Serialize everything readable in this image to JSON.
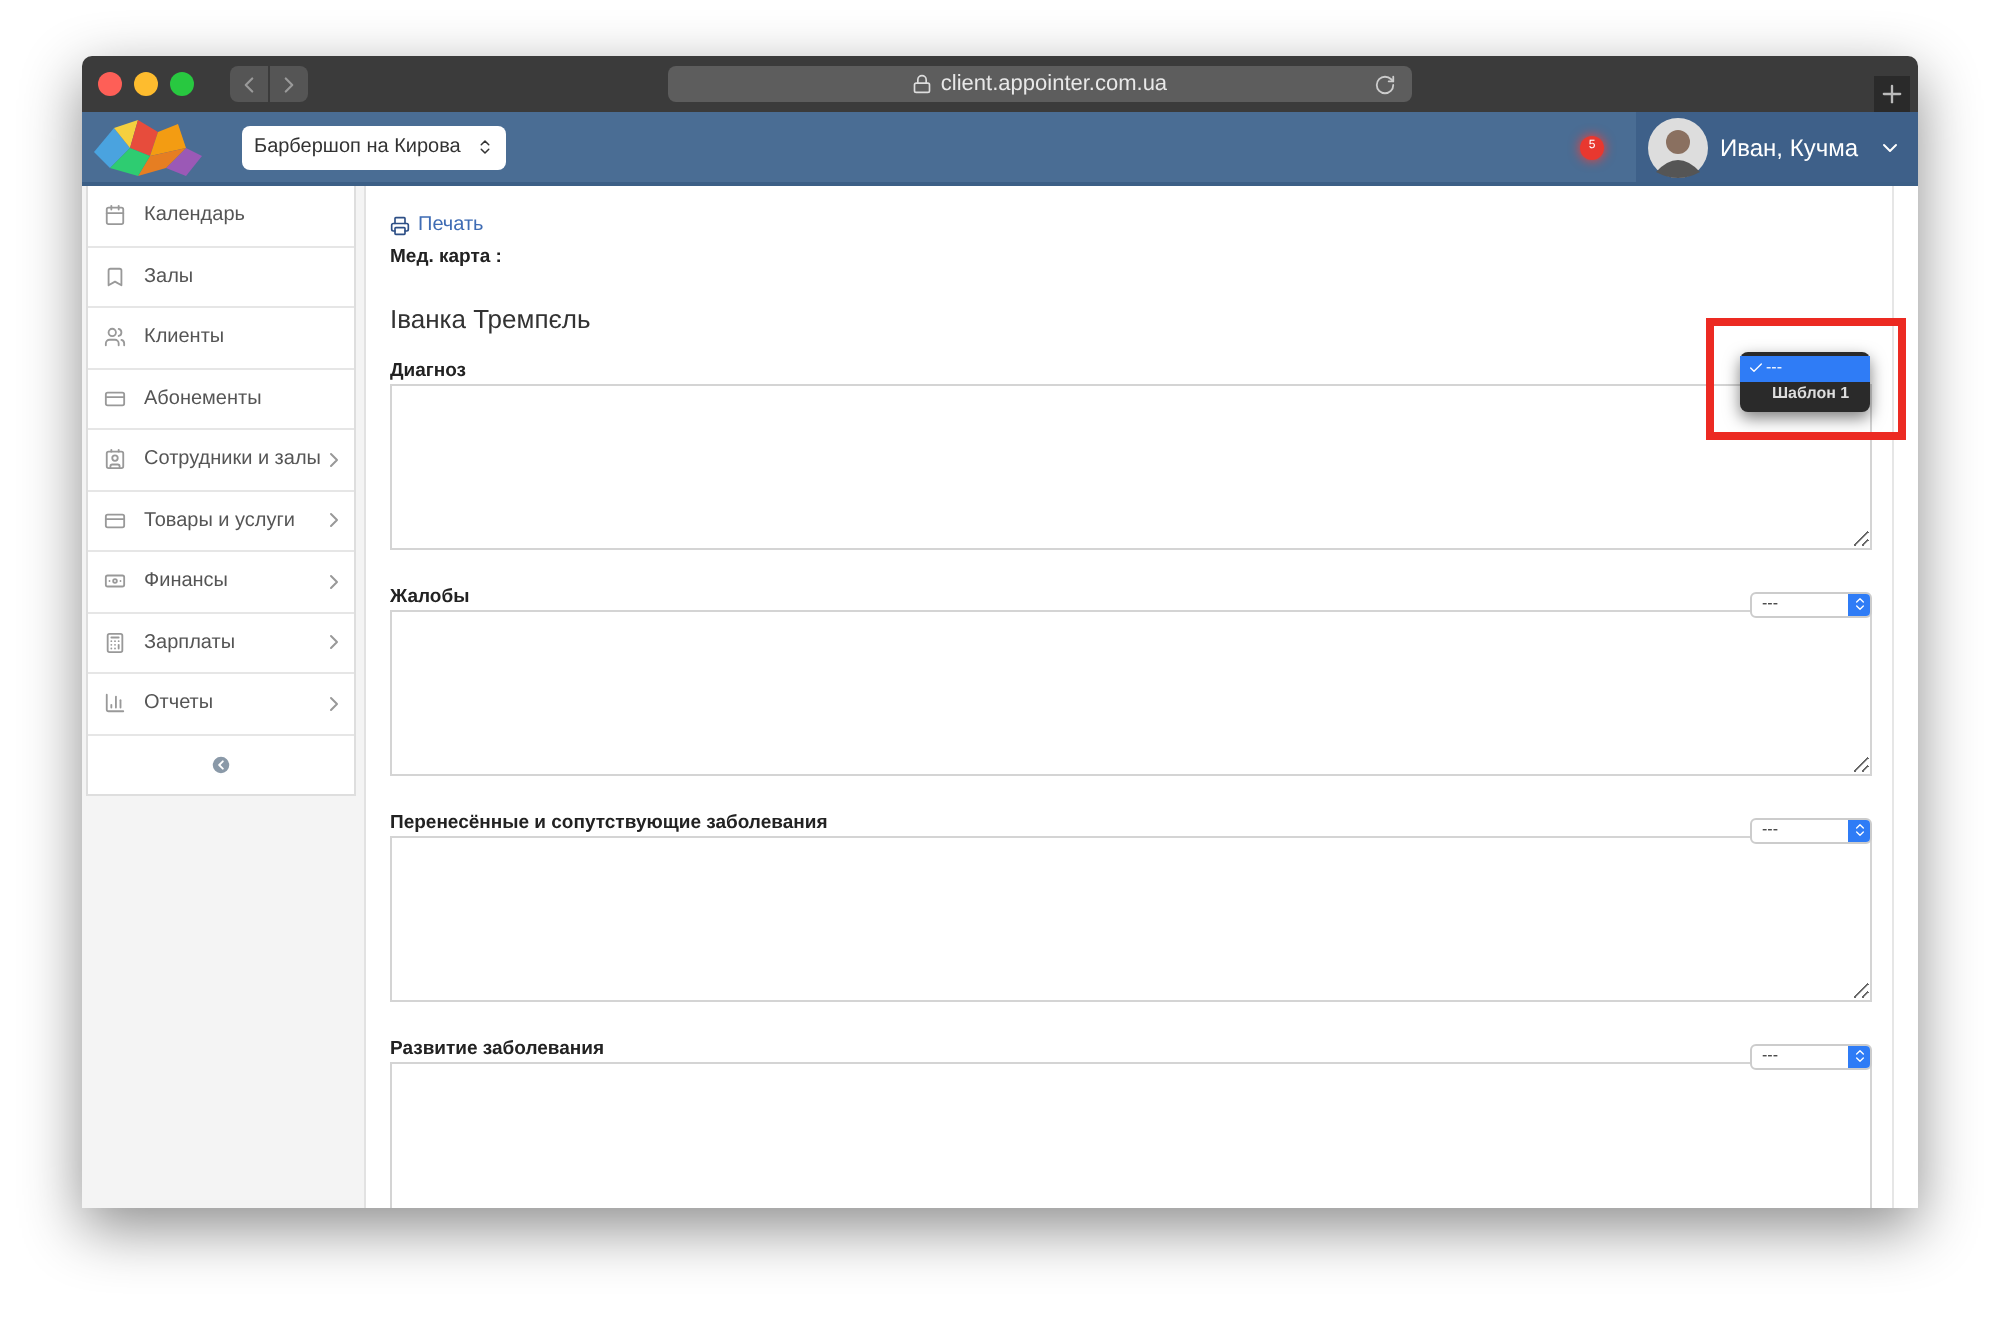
{
  "browser": {
    "url": "client.appointer.com.ua"
  },
  "header": {
    "location": "Барбершоп на Кирова",
    "notification_count": "5",
    "user_name": "Иван, Кучма"
  },
  "sidebar": {
    "items": [
      {
        "label": "Календарь",
        "kind": "calendar",
        "has_arrow": false
      },
      {
        "label": "Залы",
        "kind": "bookmark",
        "has_arrow": false
      },
      {
        "label": "Клиенты",
        "kind": "users",
        "has_arrow": false
      },
      {
        "label": "Абонементы",
        "kind": "card",
        "has_arrow": false
      },
      {
        "label": "Сотрудники и залы",
        "kind": "contact",
        "has_arrow": true
      },
      {
        "label": "Товары и услуги",
        "kind": "card",
        "has_arrow": true
      },
      {
        "label": "Финансы",
        "kind": "money",
        "has_arrow": true
      },
      {
        "label": "Зарплаты",
        "kind": "calculator",
        "has_arrow": true
      },
      {
        "label": "Отчеты",
        "kind": "chart",
        "has_arrow": true
      }
    ]
  },
  "content": {
    "print_link": "Печать",
    "card_label": "Мед. карта :",
    "patient_name": "Іванка Тремпєль",
    "sections": [
      {
        "label": "Диагноз",
        "menu": [
          {
            "label": "---",
            "selected": true
          },
          {
            "label": "Шаблон 1",
            "selected": false
          }
        ]
      },
      {
        "label": "Жалобы",
        "value": "---"
      },
      {
        "label": "Перенесённые и сопутствующие заболевания",
        "value": "---"
      },
      {
        "label": "Развитие заболевания",
        "value": "---"
      }
    ]
  }
}
